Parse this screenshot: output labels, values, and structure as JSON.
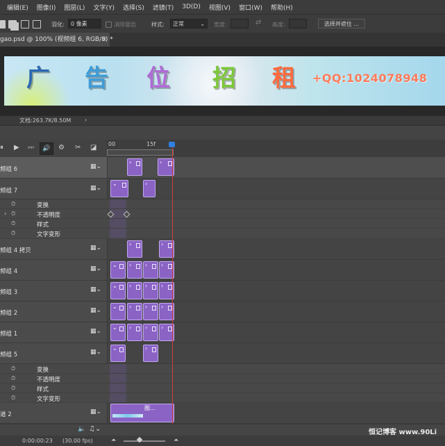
{
  "menu": [
    "编辑(E)",
    "图像(I)",
    "图层(L)",
    "文字(Y)",
    "选择(S)",
    "滤镜(T)",
    "3D(D)",
    "视图(V)",
    "窗口(W)",
    "帮助(H)"
  ],
  "options": {
    "feather_label": "羽化:",
    "feather_value": "0 像素",
    "antialias": "消除锯齿",
    "style_label": "样式:",
    "style_value": "正常",
    "width_label": "宽度:",
    "height_label": "高度:",
    "select_mask": "选择并遮住 ..."
  },
  "document": {
    "tab_title": "gao.psd @ 100% (视频组 6, RGB/8) *",
    "close": "×",
    "status": "文档:263.7K/8.50M",
    "status_arrow": "›"
  },
  "banner": {
    "chars": [
      {
        "text": "广",
        "color": "#2c6ab0"
      },
      {
        "text": "告",
        "color": "#3f9bd6"
      },
      {
        "text": "位",
        "color": "#b06bd6"
      },
      {
        "text": "招",
        "color": "#7dc83a"
      },
      {
        "text": "租",
        "color": "#ff6a3d"
      }
    ],
    "qq": "+QQ:1024078948"
  },
  "timeline": {
    "ruler": [
      "00",
      "15f"
    ],
    "layers": {
      "g6": "频组 6",
      "g7": "频组 7",
      "g4": "频组 4 拷贝",
      "g4b": "频组 4",
      "g3": "频组 3",
      "g2": "频组 2",
      "g1": "频组 1",
      "g5": "频组 5",
      "track2": "道 2"
    },
    "props": [
      "变换",
      "不透明度",
      "样式",
      "文字变形"
    ],
    "clip_label": "图...",
    "film_icon": "🎞"
  },
  "bottom": {
    "time": "0:00:00:23",
    "fps": "(30.00 fps)"
  },
  "watermark": "恒记博客 www.90Li"
}
